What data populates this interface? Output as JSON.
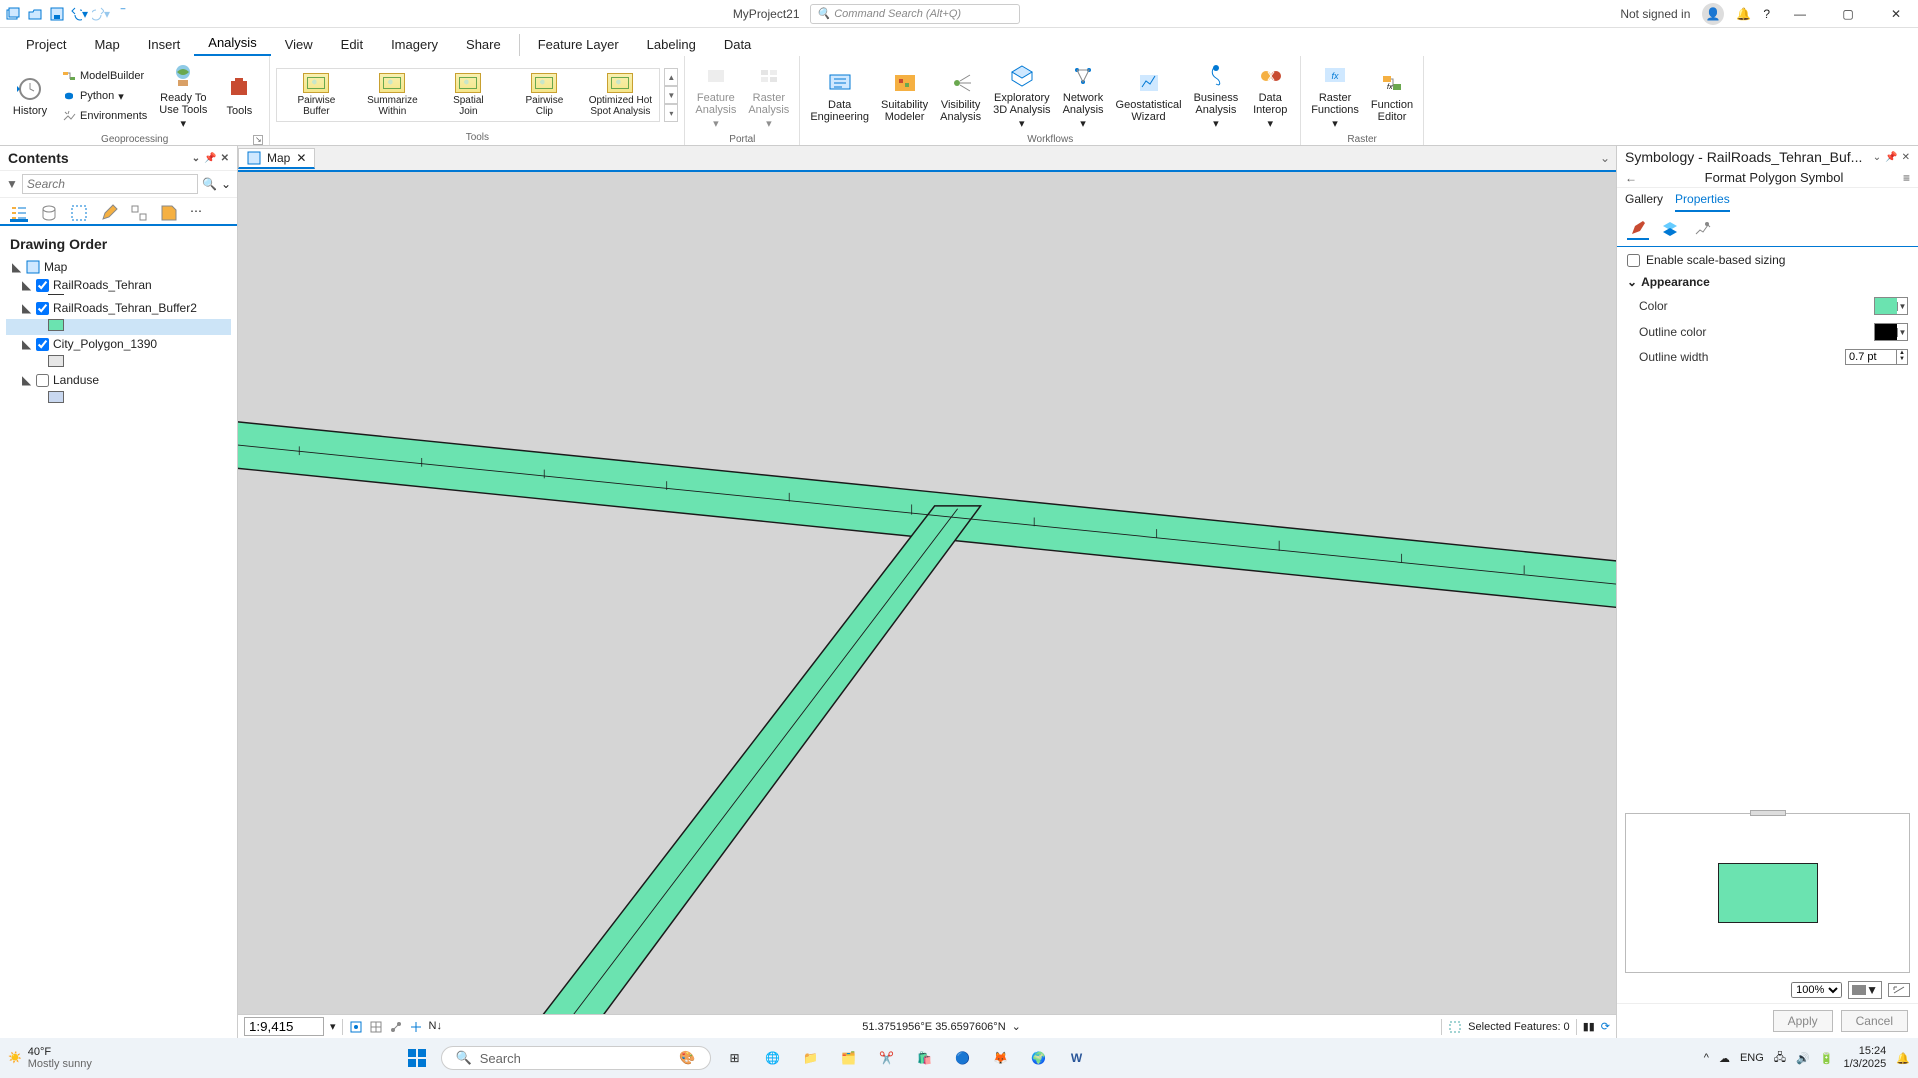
{
  "title_bar": {
    "doc_title": "MyProject21",
    "search_placeholder": "Command Search (Alt+Q)",
    "signin_text": "Not signed in"
  },
  "menu_tabs": [
    "Project",
    "Map",
    "Insert",
    "Analysis",
    "View",
    "Edit",
    "Imagery",
    "Share"
  ],
  "menu_tabs_active": "Analysis",
  "context_tabs": [
    "Feature Layer",
    "Labeling",
    "Data"
  ],
  "ribbon_groups": {
    "geoprocessing": {
      "label": "Geoprocessing",
      "history": "History",
      "modelbuilder": "ModelBuilder",
      "python": "Python",
      "environments": "Environments",
      "ready": "Ready To\nUse Tools",
      "tools": "Tools"
    },
    "tools_gallery": {
      "label": "Tools",
      "items": [
        "Pairwise\nBuffer",
        "Summarize\nWithin",
        "Spatial\nJoin",
        "Pairwise\nClip",
        "Optimized Hot\nSpot Analysis"
      ]
    },
    "portal": {
      "label": "Portal",
      "feature": "Feature\nAnalysis",
      "raster": "Raster\nAnalysis"
    },
    "workflows": {
      "label": "Workflows",
      "items": [
        "Data\nEngineering",
        "Suitability\nModeler",
        "Visibility\nAnalysis",
        "Exploratory\n3D Analysis",
        "Network\nAnalysis",
        "Geostatistical\nWizard",
        "Business\nAnalysis",
        "Data\nInterop"
      ]
    },
    "raster": {
      "label": "Raster",
      "rfunc": "Raster\nFunctions",
      "fedit": "Function\nEditor"
    }
  },
  "contents": {
    "title": "Contents",
    "search_placeholder": "Search",
    "heading": "Drawing Order",
    "layers": [
      {
        "name": "Map",
        "has_checkbox": false,
        "is_group": true
      },
      {
        "name": "RailRoads_Tehran",
        "checked": true,
        "swatch": null,
        "line_swatch": true
      },
      {
        "name": "RailRoads_Tehran_Buffer2",
        "checked": true,
        "swatch": "#6be3b0",
        "selected": true
      },
      {
        "name": "City_Polygon_1390",
        "checked": true,
        "swatch": "#e6e6e6"
      },
      {
        "name": "Landuse",
        "checked": false,
        "swatch": "#c9d8f0"
      }
    ]
  },
  "map_tabs": [
    {
      "label": "Map",
      "close": true
    }
  ],
  "map_status": {
    "scale": "1:9,415",
    "coords": "51.3751956°E 35.6597606°N",
    "selected": "Selected Features: 0"
  },
  "symbology": {
    "title": "Symbology - RailRoads_Tehran_Buf...",
    "subtitle": "Format Polygon Symbol",
    "tabs": [
      "Gallery",
      "Properties"
    ],
    "active_tab": "Properties",
    "enable_scale": "Enable scale-based sizing",
    "section": "Appearance",
    "color_label": "Color",
    "outline_color_label": "Outline color",
    "outline_width_label": "Outline width",
    "outline_width": "0.7 pt",
    "fill_color": "#6be3b0",
    "outline_color": "#000000",
    "zoom": "100%",
    "apply": "Apply",
    "cancel": "Cancel"
  },
  "taskbar": {
    "temp": "40°F",
    "cond": "Mostly sunny",
    "search": "Search",
    "lang": "ENG",
    "time": "15:24",
    "date": "1/3/2025"
  }
}
